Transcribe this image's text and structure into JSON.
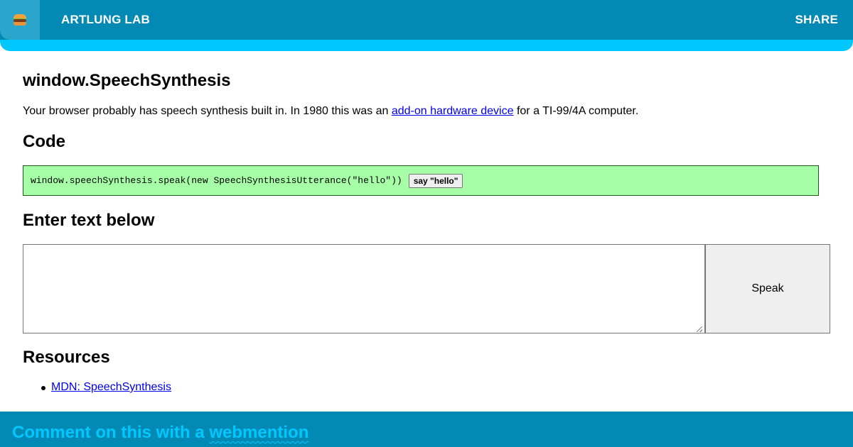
{
  "header": {
    "brand": "ARTLUNG LAB",
    "share_label": "SHARE",
    "menu_icon": "hamburger-emoji-icon"
  },
  "page": {
    "title": "window.SpeechSynthesis",
    "intro": {
      "before": "Your browser probably has speech synthesis built in. In 1980 this was an ",
      "link": "add-on hardware device",
      "after": " for a TI-99/4A computer."
    }
  },
  "code_section": {
    "heading": "Code",
    "code": "window.speechSynthesis.speak(new SpeechSynthesisUtterance(\"hello\"))",
    "button_label": "say \"hello\""
  },
  "input_section": {
    "heading": "Enter text below",
    "textarea_value": "",
    "speak_label": "Speak"
  },
  "resources": {
    "heading": "Resources",
    "items": [
      {
        "label": "MDN: SpeechSynthesis"
      }
    ]
  },
  "footer": {
    "text": "Comment on this with a ",
    "link": "webmention"
  },
  "colors": {
    "header_bg": "#028ab5",
    "accent": "#00c8ff",
    "code_bg": "#a6ffa6",
    "link": "#0000ee"
  }
}
